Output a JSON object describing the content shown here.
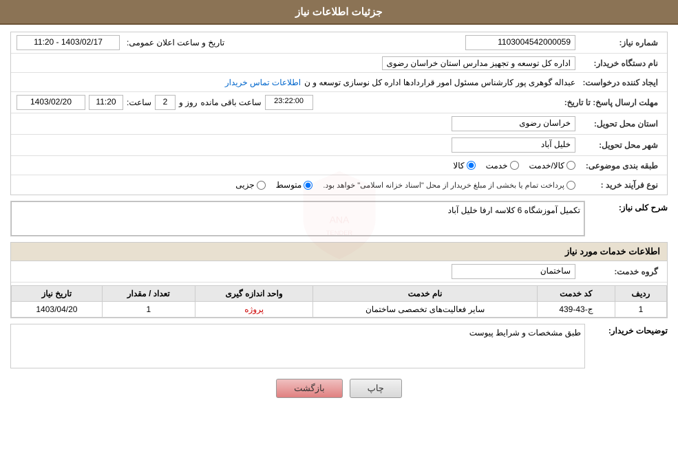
{
  "header": {
    "title": "جزئیات اطلاعات نیاز"
  },
  "fields": {
    "shomara_niaz_label": "شماره نیاز:",
    "shomara_niaz_value": "1103004542000059",
    "name_dastgah_label": "نام دستگاه خریدار:",
    "name_dastgah_value": "اداره کل توسعه  و تجهیز مدارس استان خراسان رضوی",
    "creator_label": "ایجاد کننده درخواست:",
    "creator_value": "عبداله گوهری پور کارشناس مسئول امور قراردادها  اداره کل نوسازی  توسعه و ن",
    "creator_link": "اطلاعات تماس خریدار",
    "mohlat_label": "مهلت ارسال پاسخ: تا تاریخ:",
    "date_value": "1403/02/20",
    "time_label": "ساعت:",
    "time_value": "11:20",
    "roz_label": "روز و",
    "roz_value": "2",
    "clock_value": "23:22:00",
    "remain_label": "ساعت باقی مانده",
    "ostan_label": "استان محل تحویل:",
    "ostan_value": "خراسان رضوی",
    "shahr_label": "شهر محل تحویل:",
    "shahr_value": "خلیل آباد",
    "tabaqe_label": "طبقه بندی موضوعی:",
    "tabaqe_options": [
      "کالا",
      "خدمت",
      "کالا/خدمت"
    ],
    "tabaqe_selected": "کالا",
    "noefrayand_label": "نوع فرآیند خرید :",
    "noefrayand_options": [
      "جزیی",
      "متوسط",
      "پرداخت تمام یا بخشی از مبلغ خریدار از محل \"اسناد خزانه اسلامی\" خواهد بود."
    ],
    "noefrayand_selected": "متوسط",
    "sharh_label": "شرح کلی نیاز:",
    "sharh_value": "تکمیل آموزشگاه 6 کلاسه ارفا خلیل آباد",
    "khadamat_section_title": "اطلاعات خدمات مورد نیاز",
    "group_label": "گروه خدمت:",
    "group_value": "ساختمان",
    "table": {
      "headers": [
        "ردیف",
        "کد خدمت",
        "نام خدمت",
        "واحد اندازه گیری",
        "تعداد / مقدار",
        "تاریخ نیاز"
      ],
      "rows": [
        {
          "radif": "1",
          "kod": "ج-43-439",
          "name": "سایر فعالیت‌های تخصصی ساختمان",
          "vahed": "پروژه",
          "tedad": "1",
          "tarikh": "1403/04/20"
        }
      ]
    },
    "description_label": "توضیحات خریدار:",
    "description_value": "طبق مشخصات و شرایط پیوست",
    "announcement_label": "تاریخ و ساعت اعلان عمومی:",
    "announcement_value": "1403/02/17 - 11:20"
  },
  "buttons": {
    "print_label": "چاپ",
    "back_label": "بازگشت"
  }
}
